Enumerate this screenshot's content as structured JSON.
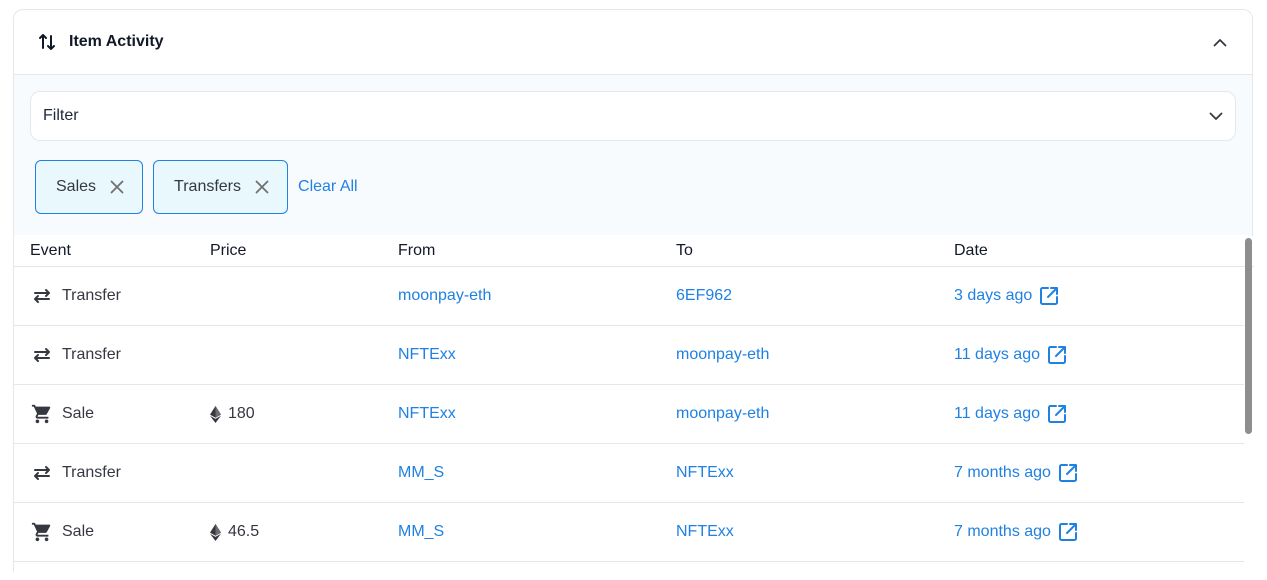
{
  "header": {
    "title": "Item Activity",
    "icon": "swap-vertical-icon",
    "collapse_icon": "chevron-up-icon"
  },
  "filter": {
    "label": "Filter",
    "icon": "chevron-down-icon"
  },
  "chips": [
    {
      "label": "Sales"
    },
    {
      "label": "Transfers"
    }
  ],
  "clear_all": "Clear All",
  "table": {
    "columns": [
      "Event",
      "Price",
      "From",
      "To",
      "Date"
    ],
    "rows": [
      {
        "event": "Transfer",
        "icon": "transfer-icon",
        "price": "",
        "from": "moonpay-eth",
        "to": "6EF962",
        "date": "3 days ago"
      },
      {
        "event": "Transfer",
        "icon": "transfer-icon",
        "price": "",
        "from": "NFTExx",
        "to": "moonpay-eth",
        "date": "11 days ago"
      },
      {
        "event": "Sale",
        "icon": "cart-icon",
        "price": "180",
        "from": "NFTExx",
        "to": "moonpay-eth",
        "date": "11 days ago"
      },
      {
        "event": "Transfer",
        "icon": "transfer-icon",
        "price": "",
        "from": "MM_S",
        "to": "NFTExx",
        "date": "7 months ago"
      },
      {
        "event": "Sale",
        "icon": "cart-icon",
        "price": "46.5",
        "from": "MM_S",
        "to": "NFTExx",
        "date": "7 months ago"
      }
    ]
  },
  "colors": {
    "accent": "#2081e2",
    "chip_bg": "#e8f8fd",
    "border": "#e5e8eb"
  }
}
